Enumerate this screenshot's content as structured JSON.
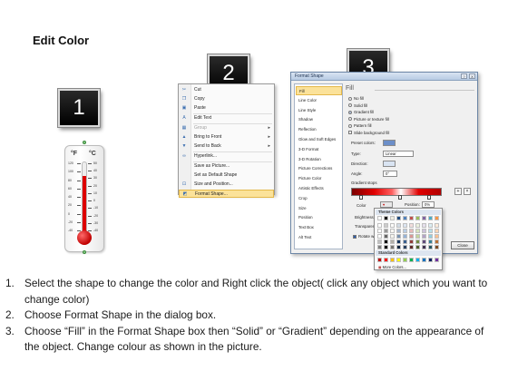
{
  "title": "Edit Color",
  "steps": [
    "1",
    "2",
    "3"
  ],
  "thermometer": {
    "unit_f": "°F",
    "unit_c": "°C",
    "fahrenheit_ticks": [
      "120",
      "100",
      "80",
      "60",
      "40",
      "20",
      "0",
      "-20",
      "-40"
    ],
    "celsius_ticks": [
      "50",
      "40",
      "30",
      "20",
      "10",
      "0",
      "-10",
      "-20",
      "-30",
      "-40"
    ],
    "mercury_level": 0.82,
    "colors": {
      "mercury": "#dd0000",
      "bulb": "#c00000"
    }
  },
  "context_menu": {
    "items": [
      {
        "label": "Cut",
        "icon": "scissors-icon",
        "disabled": false,
        "submenu": false
      },
      {
        "label": "Copy",
        "icon": "copy-icon",
        "disabled": false,
        "submenu": false
      },
      {
        "label": "Paste",
        "icon": "paste-icon",
        "disabled": false,
        "submenu": false
      },
      {
        "label": "Edit Text",
        "icon": "text-icon",
        "disabled": false,
        "submenu": false
      },
      {
        "label": "Group",
        "icon": "group-icon",
        "disabled": true,
        "submenu": true
      },
      {
        "label": "Bring to Front",
        "icon": "bring-front-icon",
        "disabled": false,
        "submenu": true
      },
      {
        "label": "Send to Back",
        "icon": "send-back-icon",
        "disabled": false,
        "submenu": true
      },
      {
        "label": "Hyperlink...",
        "icon": "hyperlink-icon",
        "disabled": false,
        "submenu": false
      },
      {
        "label": "Save as Picture...",
        "icon": "",
        "disabled": false,
        "submenu": false
      },
      {
        "label": "Set as Default Shape",
        "icon": "",
        "disabled": false,
        "submenu": false
      },
      {
        "label": "Size and Position...",
        "icon": "size-icon",
        "disabled": false,
        "submenu": false
      },
      {
        "label": "Format Shape...",
        "icon": "format-shape-icon",
        "disabled": false,
        "submenu": false,
        "highlighted": true
      }
    ]
  },
  "dialog": {
    "title": "Format Shape",
    "help": "?",
    "close": "X",
    "nav": [
      "Fill",
      "Line Color",
      "Line Style",
      "Shadow",
      "Reflection",
      "Glow and Soft Edges",
      "3-D Format",
      "3-D Rotation",
      "Picture Corrections",
      "Picture Color",
      "Artistic Effects",
      "Crop",
      "Size",
      "Position",
      "Text Box",
      "Alt Text"
    ],
    "selected_nav": "Fill",
    "pane_title": "Fill",
    "fill_options": [
      {
        "label": "No fill",
        "type": "radio",
        "checked": false
      },
      {
        "label": "Solid fill",
        "type": "radio",
        "checked": false
      },
      {
        "label": "Gradient fill",
        "type": "radio",
        "checked": true
      },
      {
        "label": "Picture or texture fill",
        "type": "radio",
        "checked": false
      },
      {
        "label": "Pattern fill",
        "type": "radio",
        "checked": false
      },
      {
        "label": "Slide background fill",
        "type": "checkbox",
        "checked": false
      }
    ],
    "preset_colors_label": "Preset colors:",
    "type_label": "Type:",
    "type_value": "Linear",
    "direction_label": "Direction:",
    "angle_label": "Angle:",
    "angle_value": "0°",
    "gradient_stops_label": "Gradient stops",
    "color_label": "Color",
    "position_label": "Position:",
    "position_value": "0%",
    "brightness_label": "Brightness",
    "transparency_label": "Transparency",
    "rotate_label": "Rotate with shape",
    "close_button": "Close"
  },
  "color_popup": {
    "theme_colors_label": "Theme Colors",
    "standard_colors_label": "Standard Colors",
    "more_colors_label": "More Colors...",
    "theme_top": [
      "#ffffff",
      "#000000",
      "#eeece1",
      "#1f497d",
      "#4f81bd",
      "#c0504d",
      "#9bbb59",
      "#8064a2",
      "#4bacc6",
      "#f79646"
    ],
    "standard": [
      "#c00000",
      "#ff0000",
      "#ffc000",
      "#ffff00",
      "#92d050",
      "#00b050",
      "#00b0f0",
      "#0070c0",
      "#002060",
      "#7030a0"
    ]
  },
  "instructions": [
    {
      "num": "1.",
      "text": "Select the shape to change the color and Right click the object( click any object which you want to change color)"
    },
    {
      "num": "2.",
      "text": "Choose Format Shape in the dialog box."
    },
    {
      "num": "3.",
      "text": "Choose “Fill” in the Format Shape box then “Solid” or “Gradient” depending on the appearance of the object. Change colour as shown in the picture."
    }
  ]
}
